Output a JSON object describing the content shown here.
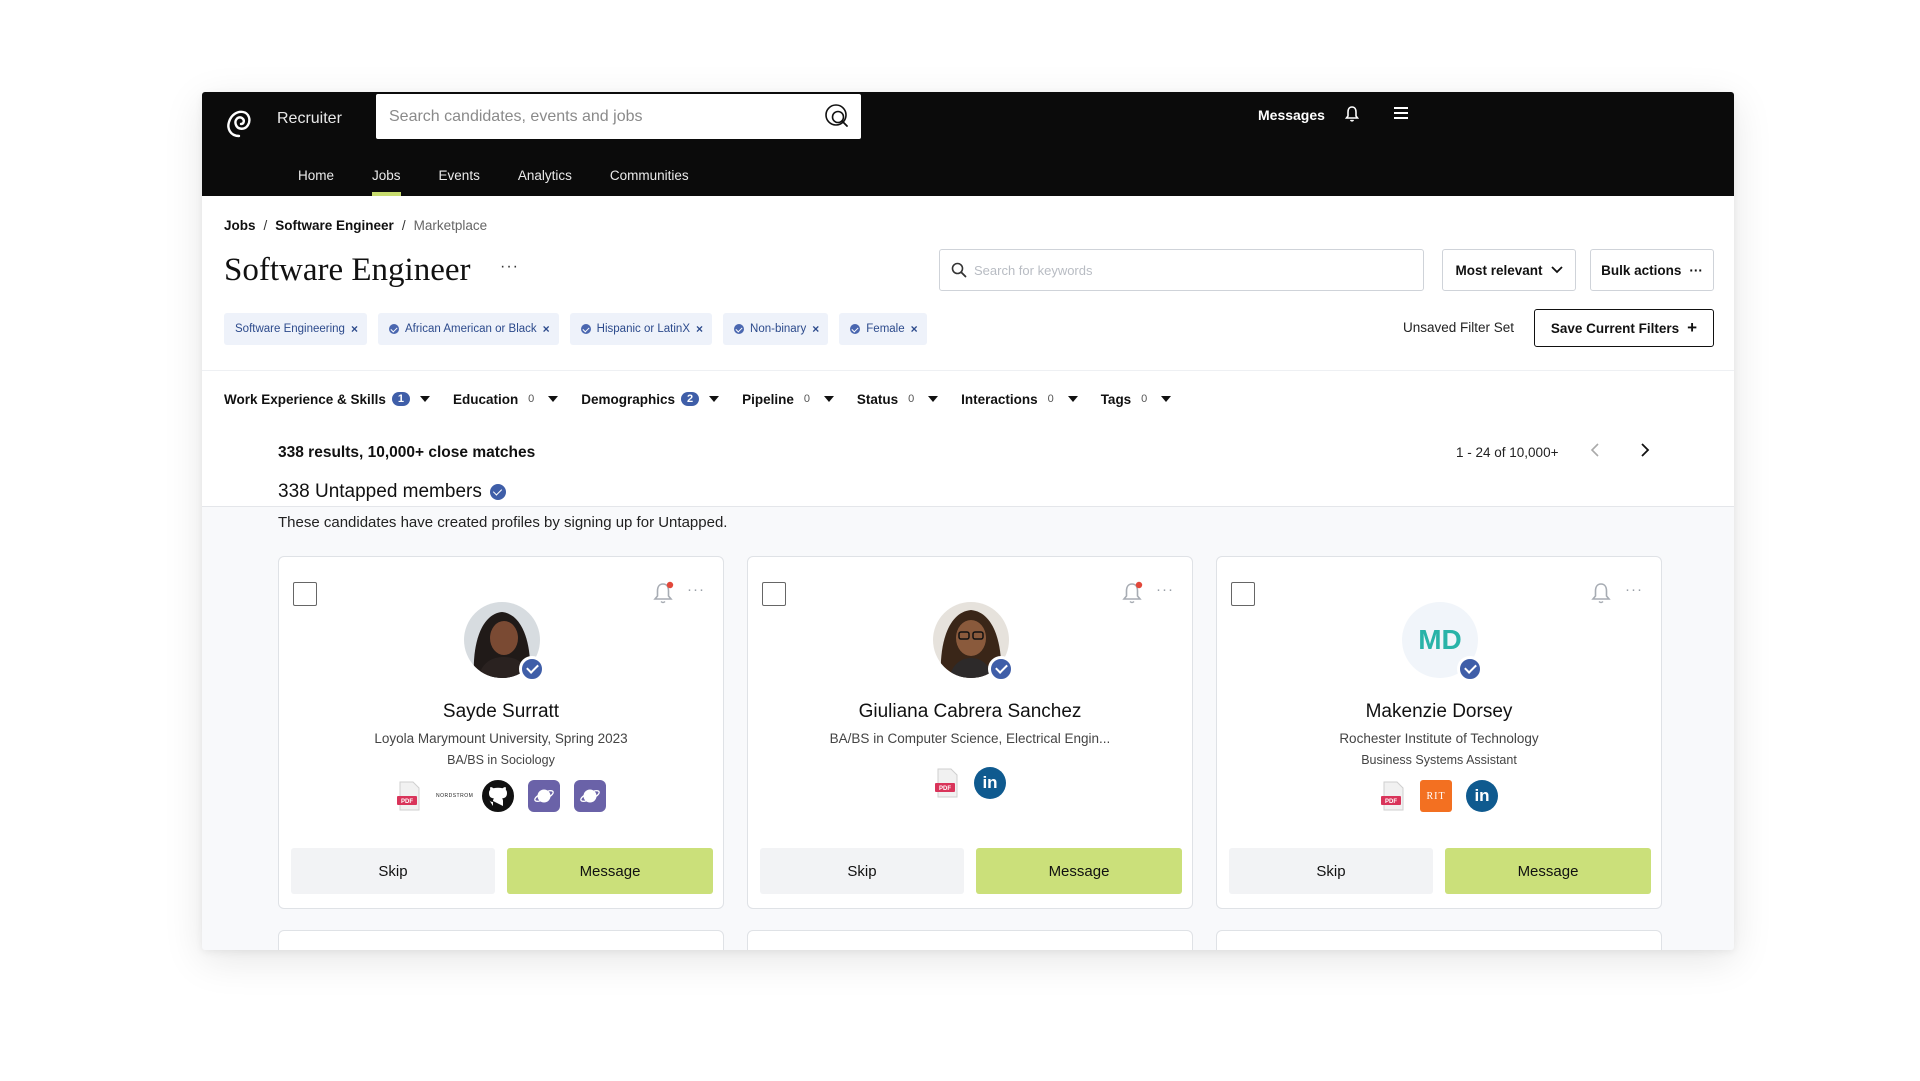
{
  "app": {
    "brand": "Recruiter"
  },
  "search": {
    "placeholder": "Search candidates, events and jobs"
  },
  "header_right": {
    "messages": "Messages"
  },
  "nav": {
    "tabs": [
      {
        "label": "Home"
      },
      {
        "label": "Jobs",
        "active": true
      },
      {
        "label": "Events"
      },
      {
        "label": "Analytics"
      },
      {
        "label": "Communities"
      }
    ]
  },
  "breadcrumb": {
    "jobs": "Jobs",
    "sep": "/",
    "job": "Software Engineer",
    "current": "Marketplace"
  },
  "page": {
    "title": "Software Engineer",
    "more": "···"
  },
  "keyword_search": {
    "placeholder": "Search for keywords"
  },
  "sort": {
    "label": "Most relevant"
  },
  "bulk": {
    "label": "Bulk actions",
    "dots": "···"
  },
  "chips": [
    {
      "label": "Software Engineering",
      "dot": false
    },
    {
      "label": "African American or Black",
      "dot": true
    },
    {
      "label": "Hispanic or LatinX",
      "dot": true
    },
    {
      "label": "Non-binary",
      "dot": true
    },
    {
      "label": "Female",
      "dot": true
    }
  ],
  "chip_close": "×",
  "filter_set": {
    "status": "Unsaved Filter Set",
    "save": "Save Current Filters",
    "save_icon": "+"
  },
  "filters": [
    {
      "label": "Work Experience & Skills",
      "count": "1",
      "badge": true
    },
    {
      "label": "Education",
      "count": "0",
      "badge": false
    },
    {
      "label": "Demographics",
      "count": "2",
      "badge": true
    },
    {
      "label": "Pipeline",
      "count": "0",
      "badge": false
    },
    {
      "label": "Status",
      "count": "0",
      "badge": false
    },
    {
      "label": "Interactions",
      "count": "0",
      "badge": false
    },
    {
      "label": "Tags",
      "count": "0",
      "badge": false
    }
  ],
  "results": {
    "summary": "338 results, 10,000+ close matches",
    "pager": "1 - 24 of 10,000+",
    "section_title": "338 Untapped members",
    "section_subtitle": "These candidates have created profiles by signing up for Untapped."
  },
  "card_actions": {
    "skip": "Skip",
    "message": "Message",
    "more": "···"
  },
  "candidates": [
    {
      "name": "Sayde Surratt",
      "line1": "Loyola Marymount University, Spring 2023",
      "line2": "BA/BS in Sociology",
      "notify": true,
      "links": [
        "pdf-icon",
        "nordstrom-logo",
        "github-icon",
        "portfolio-icon",
        "portfolio-icon"
      ],
      "nordstrom": "NORDSTROM",
      "pdf": "PDF"
    },
    {
      "name": "Giuliana Cabrera Sanchez",
      "line1": "BA/BS in Computer Science, Electrical Engin...",
      "line2": "",
      "notify": true,
      "links": [
        "pdf-icon",
        "linkedin-icon"
      ],
      "pdf": "PDF",
      "linkedin": "in"
    },
    {
      "name": "Makenzie Dorsey",
      "initials": "MD",
      "line1": "Rochester Institute of Technology",
      "line2": "Business Systems Assistant",
      "notify": false,
      "links": [
        "pdf-icon",
        "rit-logo",
        "linkedin-icon"
      ],
      "pdf": "PDF",
      "rit": "RIT",
      "linkedin": "in"
    }
  ],
  "colors": {
    "accent": "#c8dc6e",
    "message_button": "#cbe07a",
    "badge": "#3f5ea8",
    "chip_bg": "#eef2fa",
    "topbar": "#0b0b0b"
  }
}
